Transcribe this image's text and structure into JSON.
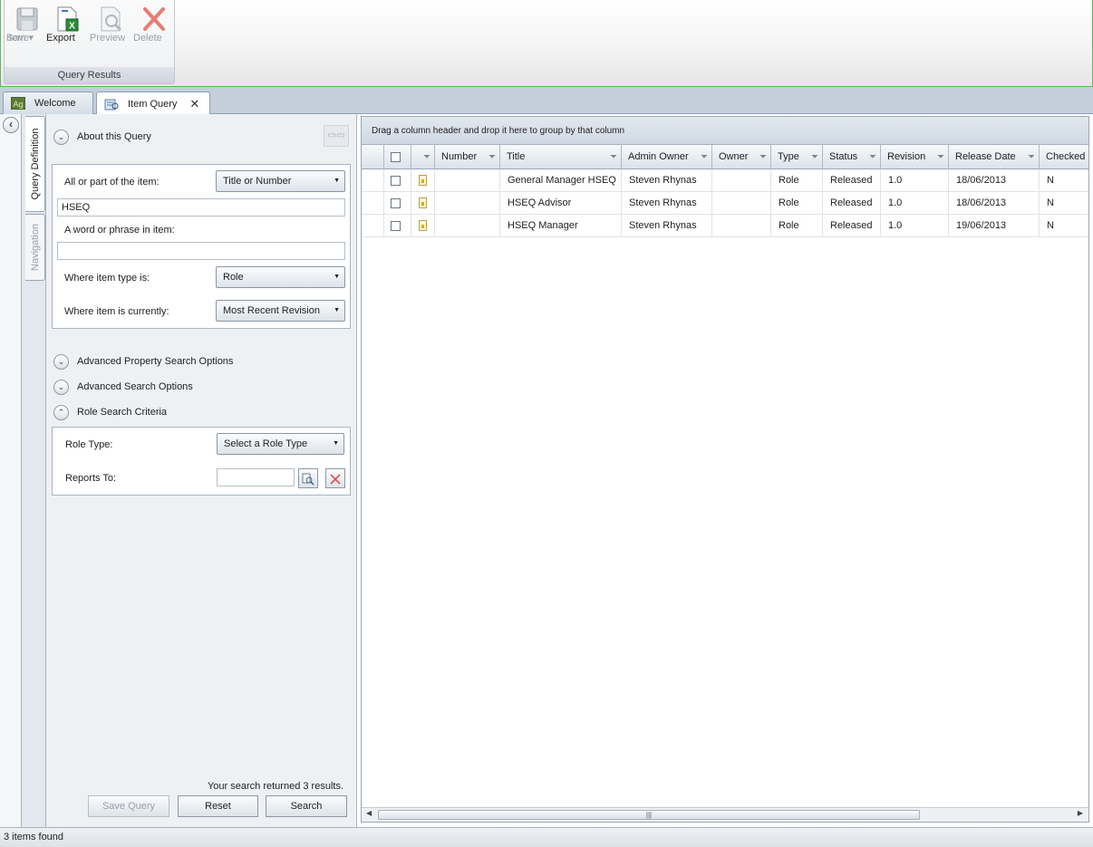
{
  "ribbon": {
    "group_title": "Query Results",
    "buttons": [
      {
        "label": "Save",
        "label2": "Item ▾",
        "icon": "save-icon",
        "enabled": false
      },
      {
        "label": "Export",
        "icon": "excel-export-icon",
        "enabled": true
      },
      {
        "label": "Preview",
        "icon": "preview-icon",
        "enabled": false
      },
      {
        "label": "Delete",
        "icon": "delete-icon",
        "enabled": false
      }
    ]
  },
  "tabs": [
    {
      "label": "Welcome",
      "icon": "app-logo-icon"
    },
    {
      "label": "Item Query",
      "icon": "query-icon",
      "close": "✕"
    }
  ],
  "side_tabs": {
    "query_definition": "Query Definition",
    "navigation": "Navigation"
  },
  "query": {
    "about_title": "About this Query",
    "clear_label": "▭▭",
    "item_label": "All or part of the item:",
    "item_scope": "Title or Number",
    "item_value": "HSEQ",
    "phrase_label": "A word or phrase in item:",
    "phrase_value": "",
    "type_label": "Where item type is:",
    "type_value": "Role",
    "current_label": "Where item is currently:",
    "current_value": "Most Recent Revision",
    "adv_property": "Advanced Property Search Options",
    "adv_search": "Advanced Search Options",
    "role_criteria": "Role Search Criteria",
    "role_type_label": "Role Type:",
    "role_type_value": "Select a Role Type",
    "reports_to_label": "Reports To:",
    "reports_to_value": "",
    "results_message": "Your search returned 3 results.",
    "save_query": "Save Query",
    "reset": "Reset",
    "search": "Search"
  },
  "grid": {
    "group_hint": "Drag a column header and drop it here to group by that column",
    "columns": [
      "Number",
      "Title",
      "Admin Owner",
      "Owner",
      "Type",
      "Status",
      "Revision",
      "Release Date",
      "Checked"
    ],
    "rows": [
      {
        "number": "",
        "title": "General Manager HSEQ",
        "admin_owner": "Steven Rhynas",
        "owner": "",
        "type": "Role",
        "status": "Released",
        "revision": "1.0",
        "release_date": "18/06/2013",
        "checked": "N"
      },
      {
        "number": "",
        "title": "HSEQ Advisor",
        "admin_owner": "Steven Rhynas",
        "owner": "",
        "type": "Role",
        "status": "Released",
        "revision": "1.0",
        "release_date": "18/06/2013",
        "checked": "N"
      },
      {
        "number": "",
        "title": "HSEQ Manager",
        "admin_owner": "Steven Rhynas",
        "owner": "",
        "type": "Role",
        "status": "Released",
        "revision": "1.0",
        "release_date": "19/06/2013",
        "checked": "N"
      }
    ]
  },
  "status": {
    "text": "3 items found"
  },
  "colors": {
    "ribbon_border": "#5fb85f",
    "tab_strip": "#c4cfdc",
    "panel_bg": "#eef1f4"
  }
}
